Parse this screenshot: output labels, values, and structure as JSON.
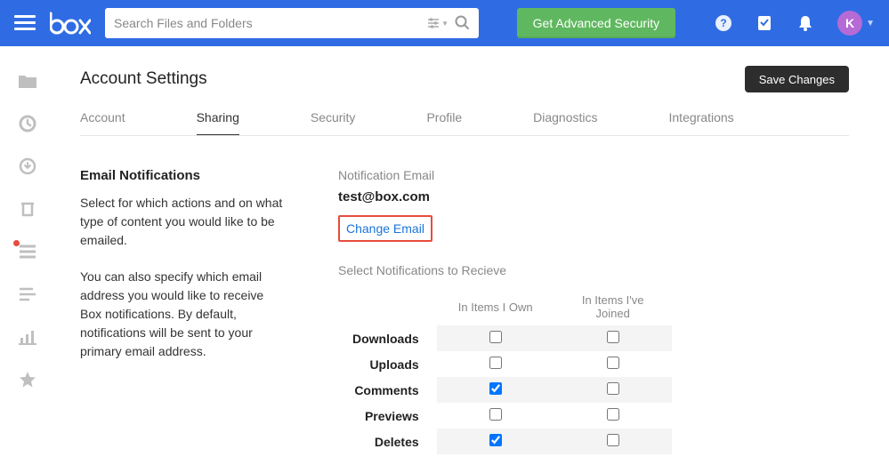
{
  "search": {
    "placeholder": "Search Files and Folders"
  },
  "cta": {
    "label": "Get Advanced Security"
  },
  "avatar": {
    "initial": "K"
  },
  "page": {
    "title": "Account Settings",
    "save": "Save Changes"
  },
  "tabs": {
    "account": "Account",
    "sharing": "Sharing",
    "security": "Security",
    "profile": "Profile",
    "diagnostics": "Diagnostics",
    "integrations": "Integrations"
  },
  "notif": {
    "section_title": "Email Notifications",
    "desc1": "Select for which actions and on what type of content you would like to be emailed.",
    "desc2": "You can also specify which email address you would like to receive Box notifications. By default, notifications will be sent to your primary email address.",
    "email_label": "Notification Email",
    "email_value": "test@box.com",
    "change_link": "Change Email",
    "select_label": "Select Notifications to Recieve",
    "col1": "In Items I Own",
    "col2": "In Items I've Joined",
    "rows": {
      "downloads": "Downloads",
      "uploads": "Uploads",
      "comments": "Comments",
      "previews": "Previews",
      "deletes": "Deletes"
    }
  }
}
